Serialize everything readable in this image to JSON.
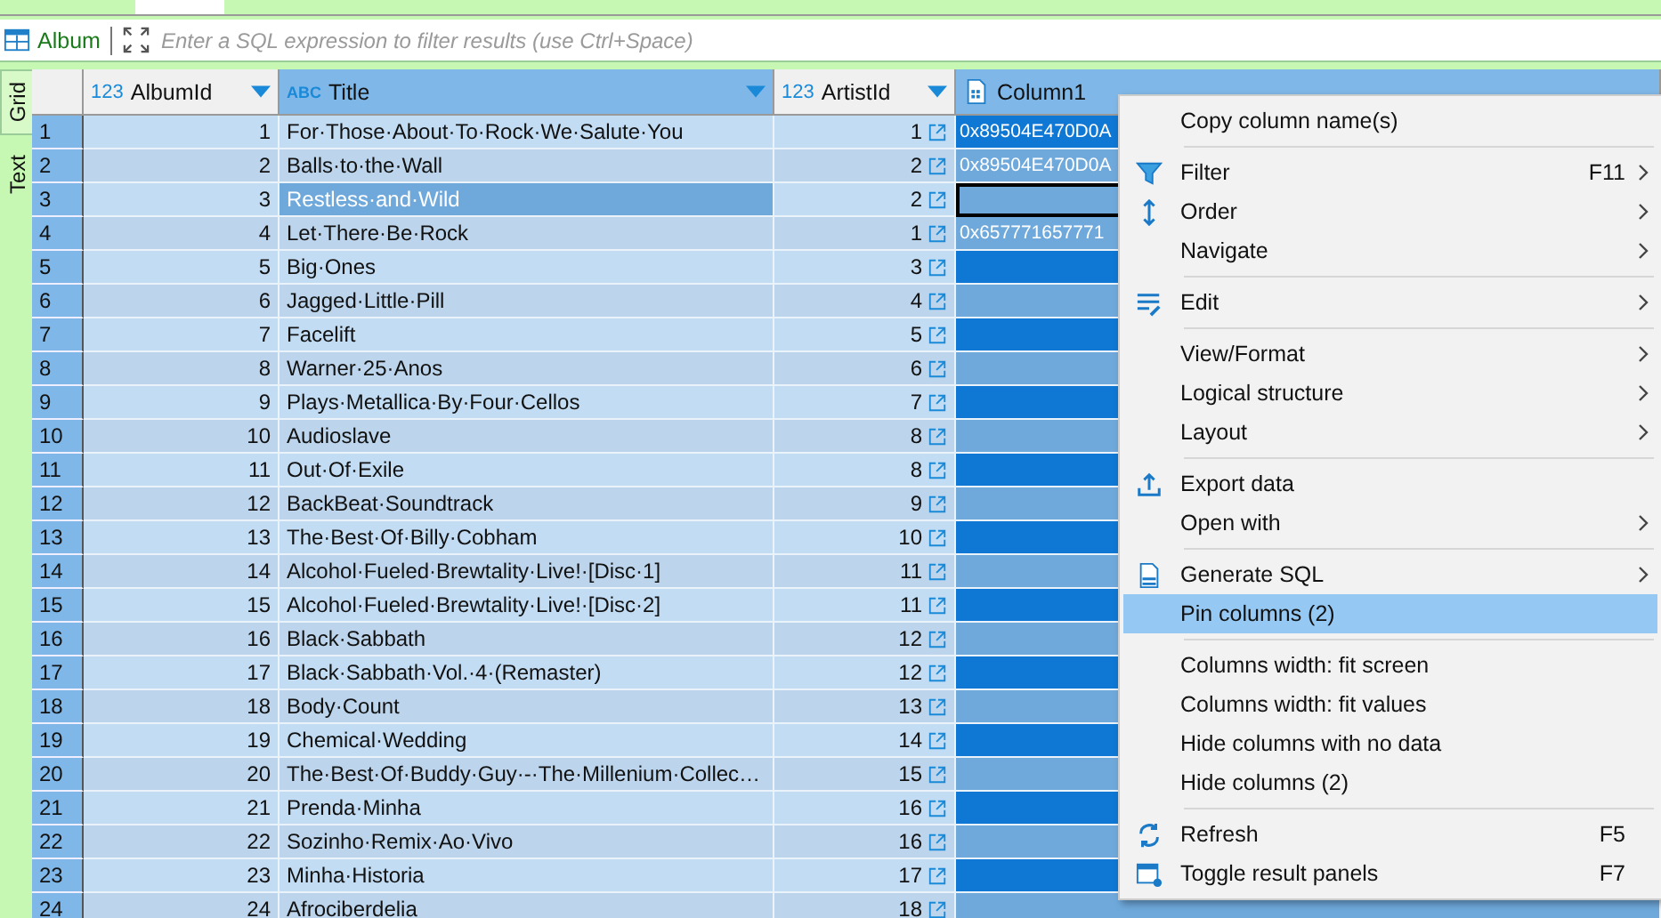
{
  "entity": {
    "name": "Album"
  },
  "filter": {
    "placeholder": "Enter a SQL expression to filter results (use Ctrl+Space)"
  },
  "side_tabs": [
    {
      "label": "Grid",
      "selected": true
    },
    {
      "label": "Text",
      "selected": false
    }
  ],
  "columns": [
    {
      "type_label": "123",
      "name": "AlbumId",
      "kind": "key",
      "selected": false
    },
    {
      "type_label": "ABC",
      "name": "Title",
      "kind": "text",
      "selected": true
    },
    {
      "type_label": "123",
      "name": "ArtistId",
      "kind": "number",
      "selected": false
    },
    {
      "name": "Column1",
      "kind": "binary",
      "selected": true
    }
  ],
  "rows": [
    {
      "num": "1",
      "album_id": "1",
      "title": "For·Those·About·To·Rock·We·Salute·You",
      "artist_id": "1",
      "column1": "0x89504E470D0A",
      "selected": false
    },
    {
      "num": "2",
      "album_id": "2",
      "title": "Balls·to·the·Wall",
      "artist_id": "2",
      "column1": "0x89504E470D0A",
      "selected": false
    },
    {
      "num": "3",
      "album_id": "3",
      "title": "Restless·and·Wild",
      "artist_id": "2",
      "selected": true
    },
    {
      "num": "4",
      "album_id": "4",
      "title": "Let·There·Be·Rock",
      "artist_id": "1",
      "column1": "0x657771657771",
      "selected": false
    },
    {
      "num": "5",
      "album_id": "5",
      "title": "Big·Ones",
      "artist_id": "3",
      "selected": false
    },
    {
      "num": "6",
      "album_id": "6",
      "title": "Jagged·Little·Pill",
      "artist_id": "4",
      "selected": false
    },
    {
      "num": "7",
      "album_id": "7",
      "title": "Facelift",
      "artist_id": "5",
      "selected": false
    },
    {
      "num": "8",
      "album_id": "8",
      "title": "Warner·25·Anos",
      "artist_id": "6",
      "selected": false
    },
    {
      "num": "9",
      "album_id": "9",
      "title": "Plays·Metallica·By·Four·Cellos",
      "artist_id": "7",
      "selected": false
    },
    {
      "num": "10",
      "album_id": "10",
      "title": "Audioslave",
      "artist_id": "8",
      "selected": false
    },
    {
      "num": "11",
      "album_id": "11",
      "title": "Out·Of·Exile",
      "artist_id": "8",
      "selected": false
    },
    {
      "num": "12",
      "album_id": "12",
      "title": "BackBeat·Soundtrack",
      "artist_id": "9",
      "selected": false
    },
    {
      "num": "13",
      "album_id": "13",
      "title": "The·Best·Of·Billy·Cobham",
      "artist_id": "10",
      "selected": false
    },
    {
      "num": "14",
      "album_id": "14",
      "title": "Alcohol·Fueled·Brewtality·Live!·[Disc·1]",
      "artist_id": "11",
      "selected": false
    },
    {
      "num": "15",
      "album_id": "15",
      "title": "Alcohol·Fueled·Brewtality·Live!·[Disc·2]",
      "artist_id": "11",
      "selected": false
    },
    {
      "num": "16",
      "album_id": "16",
      "title": "Black·Sabbath",
      "artist_id": "12",
      "selected": false
    },
    {
      "num": "17",
      "album_id": "17",
      "title": "Black·Sabbath·Vol.·4·(Remaster)",
      "artist_id": "12",
      "selected": false
    },
    {
      "num": "18",
      "album_id": "18",
      "title": "Body·Count",
      "artist_id": "13",
      "selected": false
    },
    {
      "num": "19",
      "album_id": "19",
      "title": "Chemical·Wedding",
      "artist_id": "14",
      "selected": false
    },
    {
      "num": "20",
      "album_id": "20",
      "title": "The·Best·Of·Buddy·Guy·-·The·Millenium·Collec…",
      "artist_id": "15",
      "selected": false
    },
    {
      "num": "21",
      "album_id": "21",
      "title": "Prenda·Minha",
      "artist_id": "16",
      "selected": false
    },
    {
      "num": "22",
      "album_id": "22",
      "title": "Sozinho·Remix·Ao·Vivo",
      "artist_id": "16",
      "selected": false
    },
    {
      "num": "23",
      "album_id": "23",
      "title": "Minha·Historia",
      "artist_id": "17",
      "selected": false
    },
    {
      "num": "24",
      "album_id": "24",
      "title": "Afrociberdelia",
      "artist_id": "18",
      "selected": false
    }
  ],
  "context_menu": {
    "groups": [
      [
        {
          "label": "Copy column name(s)",
          "submenu": false,
          "selected": false
        }
      ],
      [
        {
          "label": "Filter",
          "kind": "filter",
          "shortcut": "F11",
          "submenu": true,
          "selected": false
        },
        {
          "label": "Order",
          "kind": "order",
          "submenu": true,
          "selected": false
        },
        {
          "label": "Navigate",
          "submenu": true,
          "selected": false
        }
      ],
      [
        {
          "label": "Edit",
          "kind": "edit",
          "submenu": true,
          "selected": false
        }
      ],
      [
        {
          "label": "View/Format",
          "submenu": true,
          "selected": false
        },
        {
          "label": "Logical structure",
          "submenu": true,
          "selected": false
        },
        {
          "label": "Layout",
          "submenu": true,
          "selected": false
        }
      ],
      [
        {
          "label": "Export data",
          "kind": "export",
          "submenu": false,
          "selected": false
        },
        {
          "label": "Open with",
          "submenu": true,
          "selected": false
        }
      ],
      [
        {
          "label": "Generate SQL",
          "kind": "sql",
          "submenu": true,
          "selected": false
        },
        {
          "label": "Pin columns (2)",
          "submenu": false,
          "selected": true
        }
      ],
      [
        {
          "label": "Columns width: fit screen",
          "submenu": false,
          "selected": false
        },
        {
          "label": "Columns width: fit values",
          "submenu": false,
          "selected": false
        },
        {
          "label": "Hide columns with no data",
          "submenu": false,
          "selected": false
        },
        {
          "label": "Hide columns (2)",
          "submenu": false,
          "selected": false
        }
      ],
      [
        {
          "label": "Refresh",
          "kind": "refresh",
          "shortcut": "F5",
          "submenu": false,
          "selected": false
        },
        {
          "label": "Toggle result panels",
          "kind": "panels",
          "shortcut": "F7",
          "submenu": false,
          "selected": false
        }
      ]
    ]
  }
}
